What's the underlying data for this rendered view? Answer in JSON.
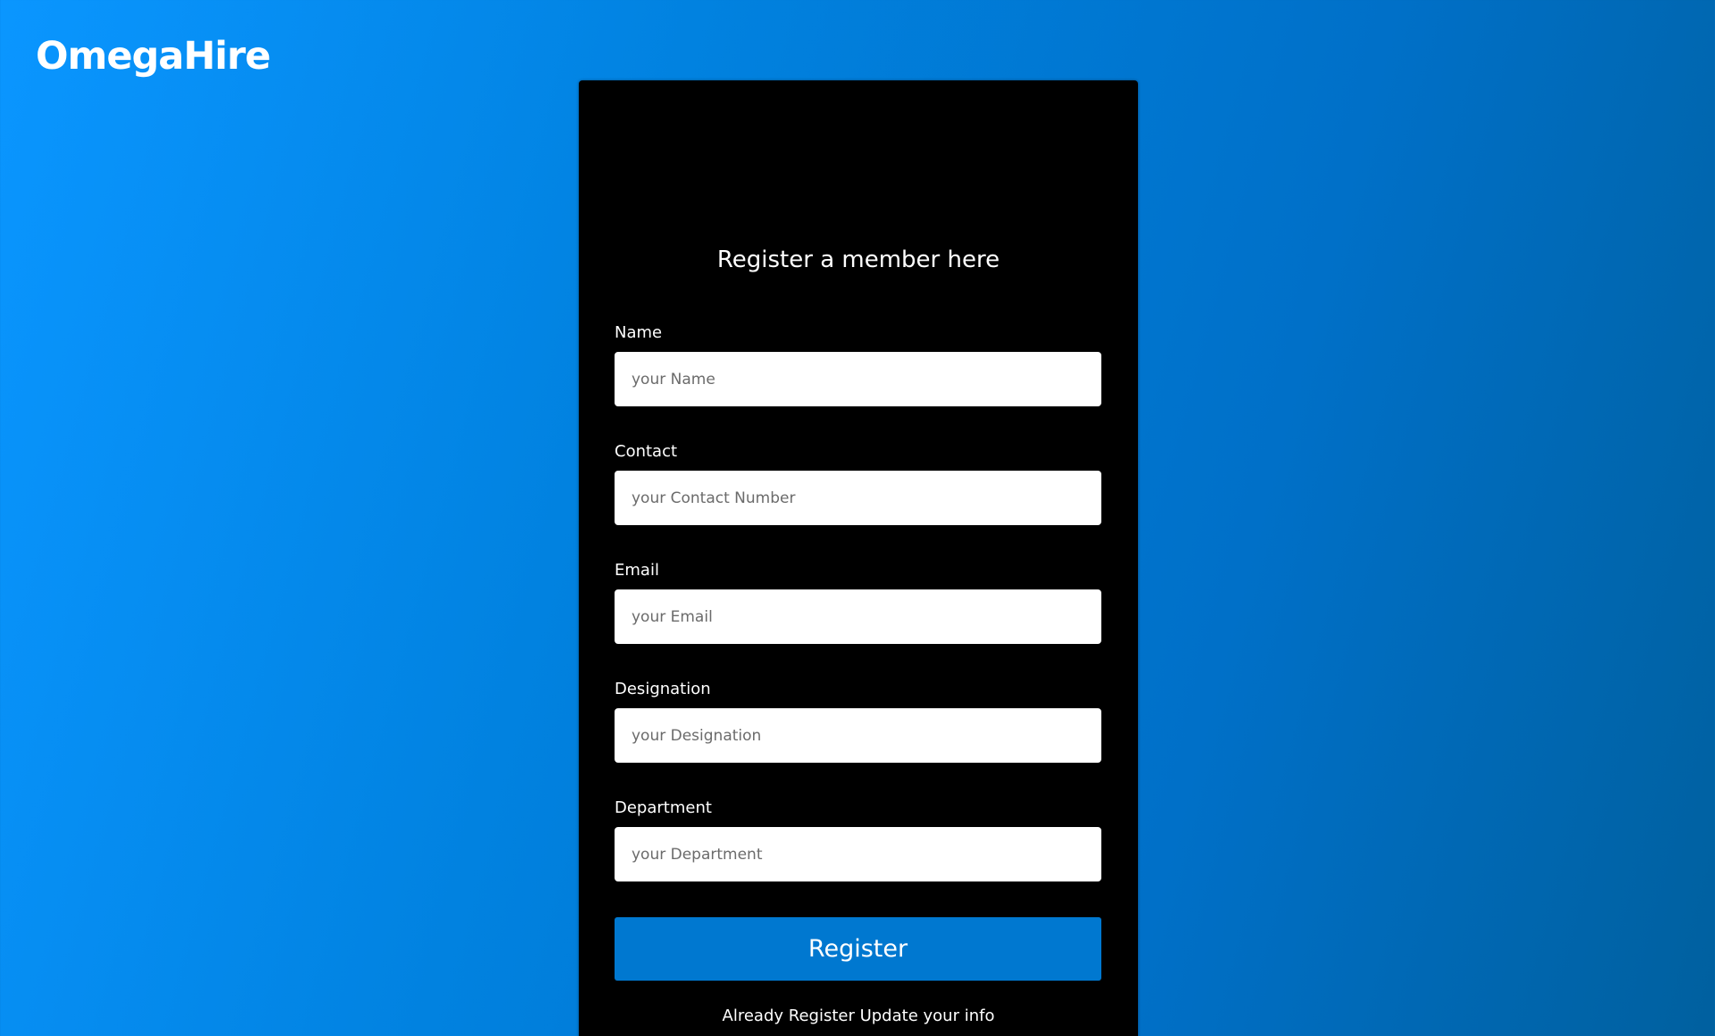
{
  "brand": {
    "logo_text": "OmegaHire"
  },
  "form": {
    "title": "Register a member here",
    "fields": [
      {
        "label": "Name",
        "placeholder": "your Name"
      },
      {
        "label": "Contact",
        "placeholder": "your Contact Number"
      },
      {
        "label": "Email",
        "placeholder": "your Email"
      },
      {
        "label": "Designation",
        "placeholder": "your Designation"
      },
      {
        "label": "Department",
        "placeholder": "your Department"
      }
    ],
    "submit_label": "Register",
    "footer_link": "Already Register Update your info"
  },
  "colors": {
    "background_start": "#0a96ff",
    "background_end": "#00609f",
    "card_background": "#000000",
    "button_background": "#0078d0"
  }
}
